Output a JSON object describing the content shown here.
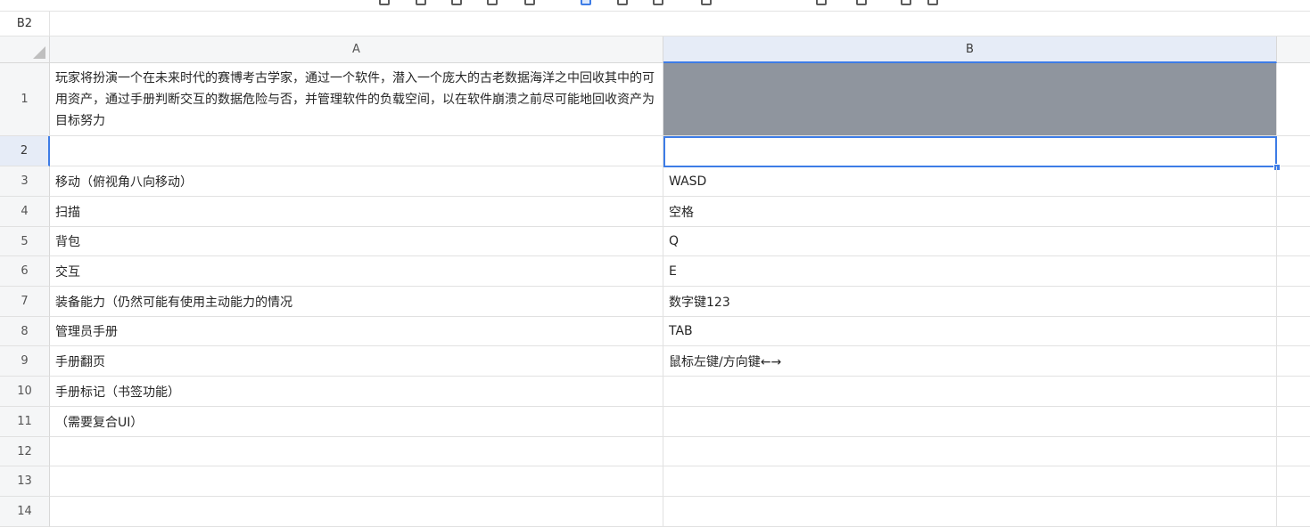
{
  "name_box": {
    "value": "B2"
  },
  "columns": [
    {
      "letter": "A"
    },
    {
      "letter": "B"
    }
  ],
  "rows": [
    {
      "num": "1",
      "a": "玩家将扮演一个在未来时代的赛博考古学家，通过一个软件，潜入一个庞大的古老数据海洋之中回收其中的可用资产，通过手册判断交互的数据危险与否，并管理软件的负载空间，以在软件崩溃之前尽可能地回收资产为目标努力",
      "b": ""
    },
    {
      "num": "2",
      "a": "",
      "b": ""
    },
    {
      "num": "3",
      "a": "移动（俯视角八向移动）",
      "b": "WASD"
    },
    {
      "num": "4",
      "a": "扫描",
      "b": "空格"
    },
    {
      "num": "5",
      "a": "背包",
      "b": "Q"
    },
    {
      "num": "6",
      "a": "交互",
      "b": "E"
    },
    {
      "num": "7",
      "a": "装备能力（仍然可能有使用主动能力的情况",
      "b": "数字键123"
    },
    {
      "num": "8",
      "a": "管理员手册",
      "b": "TAB"
    },
    {
      "num": "9",
      "a": "手册翻页",
      "b": "鼠标左键/方向键←→"
    },
    {
      "num": "10",
      "a": "手册标记（书签功能）",
      "b": ""
    },
    {
      "num": "11",
      "a": "（需要复合UI）",
      "b": ""
    },
    {
      "num": "12",
      "a": "",
      "b": ""
    },
    {
      "num": "13",
      "a": "",
      "b": ""
    },
    {
      "num": "14",
      "a": "",
      "b": ""
    }
  ],
  "colors": {
    "selection": "#3d7ce6",
    "filled_cell": "#8f959e",
    "header_bg": "#f5f6f7",
    "header_selected_bg": "#e6ecf7"
  }
}
